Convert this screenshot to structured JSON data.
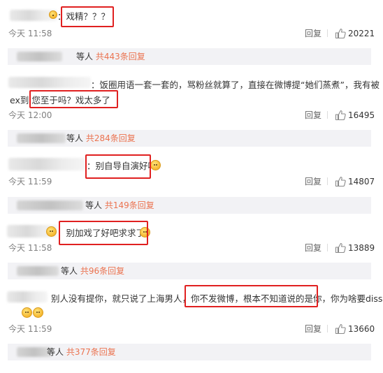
{
  "comments": [
    {
      "lines": [
        "：戏精？？？"
      ],
      "time": "今天 11:58",
      "reply_label": "回复",
      "likes": "20221",
      "sub": {
        "suffix": "等人",
        "link": "共443条回复"
      }
    },
    {
      "lines": [
        "：饭圈用语一套一套的，骂粉丝就算了，直接在微博提“她们蒸煮”，我有被",
        "ex到 您至于吗？戏太多了"
      ],
      "time": "今天 12:00",
      "reply_label": "回复",
      "likes": "16495",
      "sub": {
        "suffix": "等人",
        "link": "共284条回复"
      }
    },
    {
      "lines": [
        "：别自导自演好吗"
      ],
      "time": "今天 11:59",
      "reply_label": "回复",
      "likes": "14807",
      "sub": {
        "suffix": "等人",
        "link": "共149条回复"
      }
    },
    {
      "lines": [
        "：别加戏了好吧求求了"
      ],
      "time": "今天 11:58",
      "reply_label": "回复",
      "likes": "13889",
      "sub": {
        "suffix": "等人",
        "link": "共96条回复"
      }
    },
    {
      "lines": [
        "别人没有提你，就只说了上海男人，你不发微博，根本不知道说的是你，你为啥要diss"
      ],
      "time": "今天 11:59",
      "reply_label": "回复",
      "likes": "13660",
      "sub": {
        "suffix": "等人",
        "link": "共377条回复"
      }
    }
  ],
  "colors": {
    "highlight_box": "#e02020",
    "link": "#eb7350",
    "sub_bar": "#f2f2f5"
  }
}
